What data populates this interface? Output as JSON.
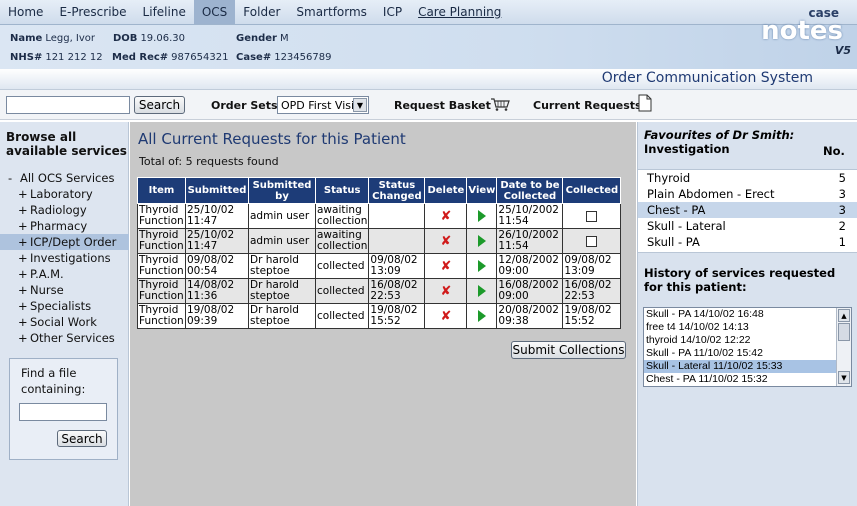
{
  "nav": {
    "items": [
      "Home",
      "E-Prescribe",
      "Lifeline",
      "OCS",
      "Folder",
      "Smartforms",
      "ICP",
      "Care Planning"
    ],
    "active": "OCS"
  },
  "patient": {
    "name_label": "Name",
    "name": "Legg, Ivor",
    "dob_label": "DOB",
    "dob": "19.06.30",
    "gender_label": "Gender",
    "gender": "M",
    "nhs_label": "NHS#",
    "nhs": "121 212 12",
    "medrec_label": "Med Rec#",
    "medrec": "987654321",
    "case_label": "Case#",
    "case": "123456789"
  },
  "logo": {
    "case": "case",
    "notes": "notes",
    "version": "V5"
  },
  "system_title": "Order Communication System",
  "toolbar": {
    "search_placeholder": "",
    "search_button": "Search",
    "order_sets_label": "Order Sets",
    "order_sets_value": "OPD First Visit",
    "request_basket_label": "Request Basket",
    "current_requests_label": "Current Requests"
  },
  "left": {
    "heading_line1": "Browse all",
    "heading_line2": "available services",
    "tree": [
      {
        "sym": "-",
        "label": "All OCS Services",
        "indent": 0
      },
      {
        "sym": "+",
        "label": "Laboratory",
        "indent": 1
      },
      {
        "sym": "+",
        "label": "Radiology",
        "indent": 1
      },
      {
        "sym": "+",
        "label": "Pharmacy",
        "indent": 1
      },
      {
        "sym": "+",
        "label": "ICP/Dept Order",
        "indent": 1
      },
      {
        "sym": "+",
        "label": "Investigations",
        "indent": 1
      },
      {
        "sym": "+",
        "label": "P.A.M.",
        "indent": 1
      },
      {
        "sym": "+",
        "label": "Nurse",
        "indent": 1
      },
      {
        "sym": "+",
        "label": "Specialists",
        "indent": 1
      },
      {
        "sym": "+",
        "label": "Social Work",
        "indent": 1
      },
      {
        "sym": "+",
        "label": "Other Services",
        "indent": 1
      }
    ],
    "active_index": 4,
    "find_label_line1": "Find a file",
    "find_label_line2": "containing:",
    "find_button": "Search"
  },
  "center": {
    "title": "All Current Requests for this Patient",
    "total": "Total of: 5 requests found",
    "columns": [
      "Item",
      "Submitted",
      "Submitted by",
      "Status",
      "Status Changed",
      "Delete",
      "View",
      "Date to be Collected",
      "Collected"
    ],
    "rows": [
      {
        "item1": "Thyroid",
        "item2": "Function",
        "sub1": "25/10/02",
        "sub2": "11:47",
        "by1": "admin user",
        "by2": "",
        "st1": "awaiting",
        "st2": "collection",
        "ch1": "",
        "ch2": "",
        "due1": "25/10/2002",
        "due2": "11:54",
        "collected": false
      },
      {
        "item1": "Thyroid",
        "item2": "Function",
        "sub1": "25/10/02",
        "sub2": "11:47",
        "by1": "admin user",
        "by2": "",
        "st1": "awaiting",
        "st2": "collection",
        "ch1": "",
        "ch2": "",
        "due1": "26/10/2002",
        "due2": "11:54",
        "collected": false
      },
      {
        "item1": "Thyroid",
        "item2": "Function",
        "sub1": "09/08/02",
        "sub2": "00:54",
        "by1": "Dr harold",
        "by2": "steptoe",
        "st1": "collected",
        "st2": "",
        "ch1": "09/08/02",
        "ch2": "13:09",
        "due1": "12/08/2002",
        "due2": "09:00",
        "col1": "09/08/02",
        "col2": "13:09"
      },
      {
        "item1": "Thyroid",
        "item2": "Function",
        "sub1": "14/08/02",
        "sub2": "11:36",
        "by1": "Dr harold",
        "by2": "steptoe",
        "st1": "collected",
        "st2": "",
        "ch1": "16/08/02",
        "ch2": "22:53",
        "due1": "16/08/2002",
        "due2": "09:00",
        "col1": "16/08/02",
        "col2": "22:53"
      },
      {
        "item1": "Thyroid",
        "item2": "Function",
        "sub1": "19/08/02",
        "sub2": "09:39",
        "by1": "Dr harold",
        "by2": "steptoe",
        "st1": "collected",
        "st2": "",
        "ch1": "19/08/02",
        "ch2": "15:52",
        "due1": "20/08/2002",
        "due2": "09:38",
        "col1": "19/08/02",
        "col2": "15:52"
      }
    ],
    "submit_button": "Submit Collections"
  },
  "right": {
    "fav_heading": "Favourites of Dr Smith:",
    "fav_sub": "Investigation",
    "fav_no": "No.",
    "favourites": [
      {
        "label": "Thyroid",
        "count": "5"
      },
      {
        "label": "Plain Abdomen - Erect",
        "count": "3"
      },
      {
        "label": "Chest - PA",
        "count": "3"
      },
      {
        "label": "Skull - Lateral",
        "count": "2"
      },
      {
        "label": "Skull - PA",
        "count": "1"
      }
    ],
    "fav_active_index": 2,
    "history_heading_line1": "History of services requested",
    "history_heading_line2": "for this patient:",
    "history": [
      "Skull - PA 14/10/02 16:48",
      "free t4 14/10/02 14:13",
      "thyroid 14/10/02 12:22",
      "Skull - PA 11/10/02 15:42",
      "Skull - Lateral 11/10/02 15:33",
      "Chest - PA 11/10/02 15:32"
    ],
    "history_active_index": 4
  },
  "colors": {
    "nav_bg": "#cfdcec",
    "header_blue": "#1d3c78",
    "title_blue": "#1f3a73",
    "center_bg": "#c8c8c8",
    "delete_red": "#d01a1a",
    "view_green": "#1c9a2a"
  }
}
